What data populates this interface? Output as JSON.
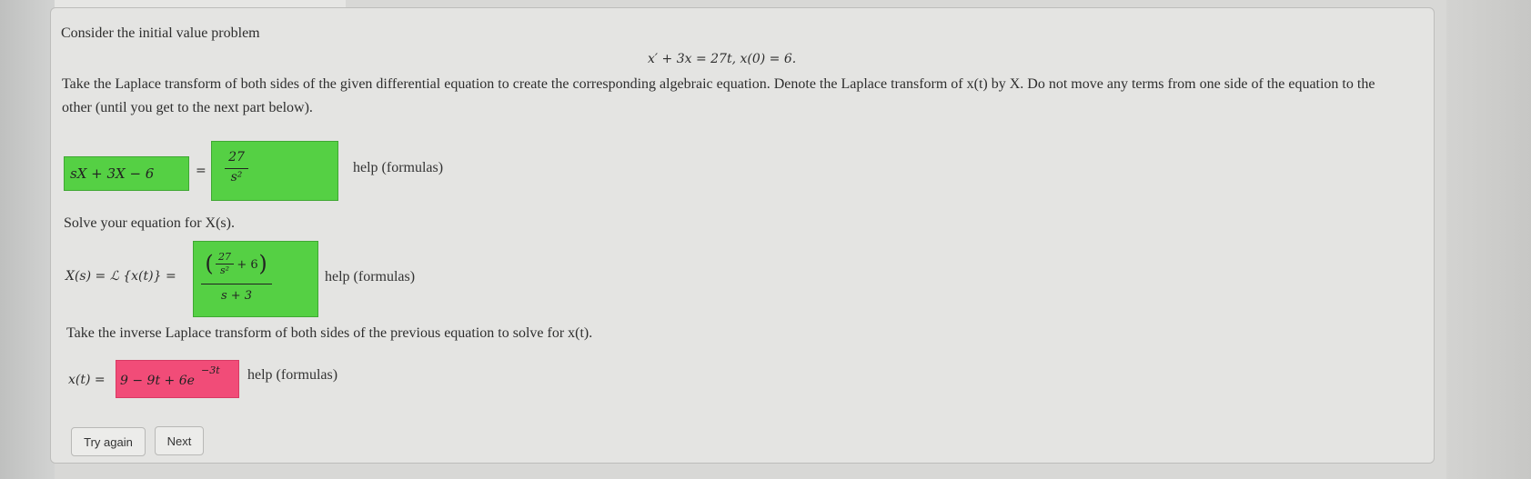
{
  "intro": "Consider the initial value problem",
  "ode": "x′ + 3x = 27t,    x(0) = 6.",
  "instruction1": "Take the Laplace transform of both sides of the given differential equation to create the corresponding algebraic equation. Denote the Laplace transform of x(t) by X. Do not move any terms from one side of the equation to the other (until you get to the next part below).",
  "part1": {
    "lhs_value": "sX + 3X − 6",
    "equals": "=",
    "rhs_numerator": "27",
    "rhs_denominator": "s²",
    "help": "help (formulas)"
  },
  "instruction2": "Solve your equation for X(s).",
  "part2": {
    "label": "X(s) = ℒ {x(t)} =",
    "inner_numerator": "27",
    "inner_denominator": "s²",
    "plus_six": "+ 6",
    "denominator": "s + 3",
    "help": "help (formulas)"
  },
  "instruction3": "Take the inverse Laplace transform of both sides of the previous equation to solve for x(t).",
  "part3": {
    "label": "x(t) =",
    "value": "9 − 9t + 6e",
    "exponent": "−3t",
    "help": "help (formulas)"
  },
  "buttons": {
    "try_again": "Try again",
    "next": "Next"
  },
  "colors": {
    "correct": "#55d044",
    "incorrect": "#f14c78"
  }
}
